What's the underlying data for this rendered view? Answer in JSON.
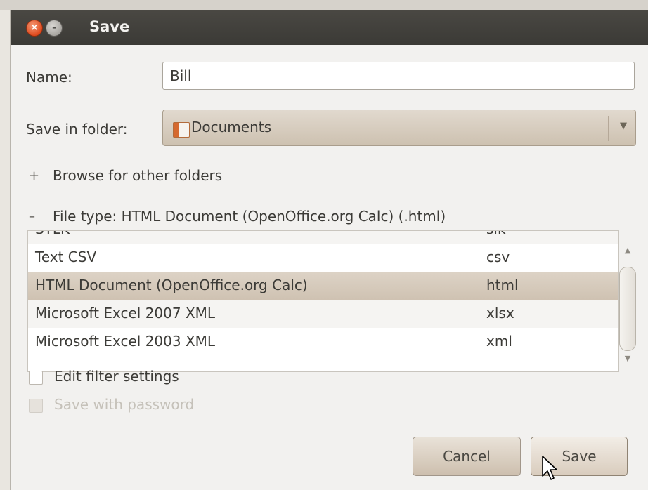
{
  "window": {
    "title": "Save"
  },
  "form": {
    "name_label": "Name:",
    "name_value": "Bill",
    "folder_label": "Save in folder:",
    "folder_value": "Documents",
    "browse_label": "Browse for other folders",
    "browse_sign": "+",
    "filetype_label": "File type: HTML Document (OpenOffice.org Calc) (.html)",
    "filetype_sign": "–"
  },
  "file_types": {
    "rows": [
      {
        "name": "SYLK",
        "ext": "slk",
        "state": "partial"
      },
      {
        "name": "Text CSV",
        "ext": "csv",
        "state": "normal"
      },
      {
        "name": "HTML Document (OpenOffice.org Calc)",
        "ext": "html",
        "state": "selected"
      },
      {
        "name": "Microsoft Excel 2007 XML",
        "ext": "xlsx",
        "state": "normal"
      },
      {
        "name": "Microsoft Excel 2003 XML",
        "ext": "xml",
        "state": "normal"
      }
    ]
  },
  "options": {
    "edit_filter_label": "Edit filter settings",
    "edit_filter_checked": false,
    "save_password_label": "Save with password",
    "save_password_checked": false,
    "save_password_enabled": false
  },
  "buttons": {
    "cancel": "Cancel",
    "save": "Save"
  },
  "colors": {
    "titlebar": "#3c3b37",
    "selection": "#d6cbbd",
    "close": "#df4a1e"
  }
}
